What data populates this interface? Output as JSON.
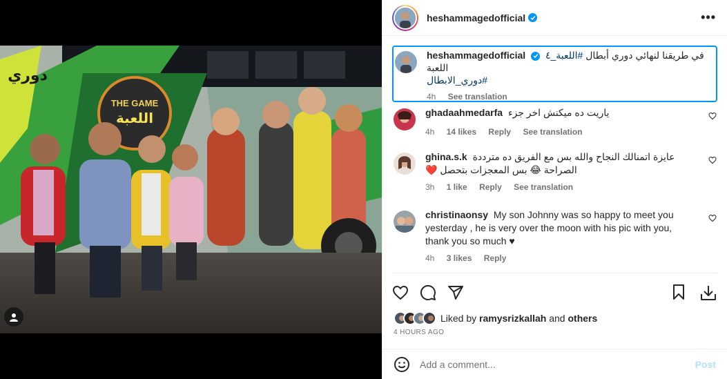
{
  "header": {
    "username": "heshammagedofficial",
    "more_label": "•••"
  },
  "caption": {
    "username": "heshammagedofficial",
    "text": "في طريقنا لنهائي دوري أبطال اللعبة",
    "hashtag1": "#اللعبة_٤",
    "hashtag2": "#دوري_الابطال",
    "time": "4h",
    "see_translation": "See translation"
  },
  "comments": [
    {
      "username": "ghadaahmedarfa",
      "text": "ياريت ده ميكنش اخر جزء",
      "time": "4h",
      "likes": "14 likes",
      "reply": "Reply",
      "see_translation": "See translation"
    },
    {
      "username": "ghina.s.k",
      "text": "عايزة اتمنالك النجاح والله بس مع الفريق ده مترددة الصراحة 😂 بس المعجزات بتحصل ❤️",
      "time": "3h",
      "likes": "1 like",
      "reply": "Reply",
      "see_translation": "See translation"
    },
    {
      "username": "christinaonsy",
      "text": "My son Johnny was so happy to meet you yesterday , he is very over the moon with his pic with you, thank you so much ♥",
      "time": "4h",
      "likes": "3 likes",
      "reply": "Reply"
    }
  ],
  "likes": {
    "prefix": "Liked by",
    "user": "ramysrizkallah",
    "and": "and",
    "others": "others"
  },
  "time_ago": "4 HOURS AGO",
  "add_comment": {
    "placeholder": "Add a comment...",
    "post_label": "Post"
  },
  "photo": {
    "sign_english": "THE GAME",
    "sign_arabic": "اللعبة",
    "bus_text": "دوري"
  },
  "icons": {
    "verified": "verified-badge-icon",
    "heart": "heart-icon",
    "comment": "comment-icon",
    "share": "share-icon",
    "save": "bookmark-icon",
    "download": "download-icon",
    "emoji": "emoji-icon",
    "tag": "user-tag-icon",
    "more": "more-options-icon"
  },
  "colors": {
    "verified": "#0095f6",
    "post_button_disabled": "#b2dffc",
    "hashtag": "#00376b",
    "selected_caption_border": "#0095f6"
  }
}
